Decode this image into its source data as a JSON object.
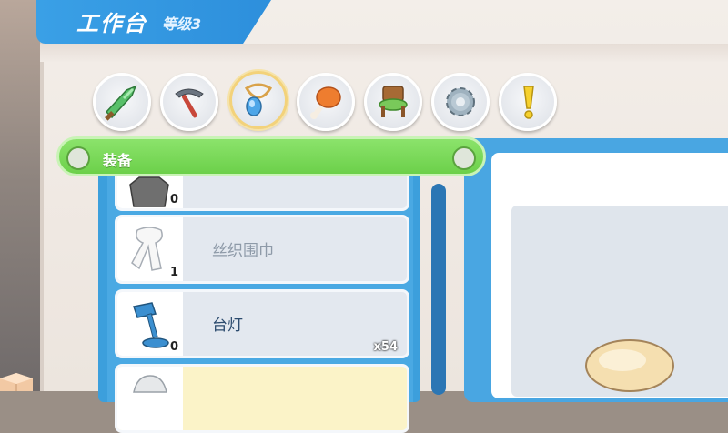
{
  "header": {
    "title": "工作台",
    "level": "等级3"
  },
  "tabs": [
    {
      "icon": "sword-icon",
      "active": false
    },
    {
      "icon": "pickaxe-icon",
      "active": false
    },
    {
      "icon": "pendant-icon",
      "active": true
    },
    {
      "icon": "drumstick-icon",
      "active": false
    },
    {
      "icon": "chair-icon",
      "active": false
    },
    {
      "icon": "gear-icon",
      "active": false
    },
    {
      "icon": "exclamation-icon",
      "active": false
    }
  ],
  "category": {
    "label": "装备"
  },
  "items": [
    {
      "name": "",
      "count": "0",
      "icon": "gray-armor-icon"
    },
    {
      "name": "丝织围巾",
      "count": "1",
      "icon": "scarf-icon"
    },
    {
      "name": "台灯",
      "count": "0",
      "qty": "x54",
      "icon": "desk-lamp-icon"
    },
    {
      "name": "",
      "count": "",
      "icon": "item-icon"
    }
  ],
  "colors": {
    "accent_blue": "#3aa0e6",
    "category_green": "#6cd04a",
    "highlight_yellow": "#fbf3c8"
  }
}
